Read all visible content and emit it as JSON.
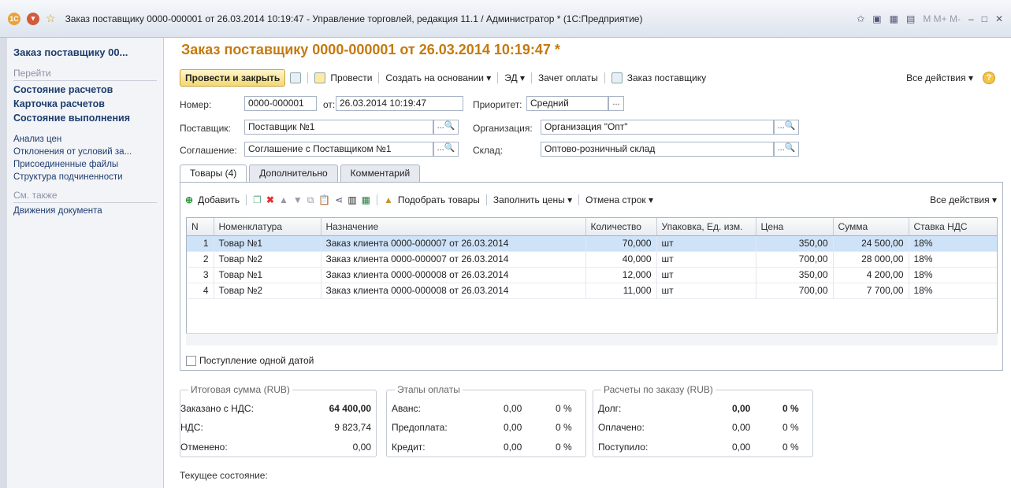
{
  "window": {
    "title": "Заказ поставщику 0000-000001 от 26.03.2014 10:19:47 - Управление торговлей, редакция 11.1 / Администратор * (1С:Предприятие)",
    "right_tools": "M  M+  M-"
  },
  "sidebar": {
    "title": "Заказ поставщику 00...",
    "goto_header": "Перейти",
    "bold_links": [
      "Состояние расчетов",
      "Карточка расчетов",
      "Состояние выполнения"
    ],
    "links": [
      "Анализ цен",
      "Отклонения от условий за...",
      "Присоединенные файлы",
      "Структура подчиненности"
    ],
    "see_also_header": "См. также",
    "see_also_links": [
      "Движения документа"
    ]
  },
  "doc": {
    "title": "Заказ поставщику 0000-000001 от 26.03.2014 10:19:47 *"
  },
  "toolbar": {
    "post_close": "Провести и закрыть",
    "post": "Провести",
    "create_based": "Создать на основании ▾",
    "ed": "ЭД ▾",
    "payment_offset": "Зачет оплаты",
    "print_order": "Заказ поставщику",
    "all_actions": "Все действия ▾"
  },
  "form": {
    "number_label": "Номер:",
    "number": "0000-000001",
    "date_label": "от:",
    "date": "26.03.2014 10:19:47",
    "priority_label": "Приоритет:",
    "priority": "Средний",
    "supplier_label": "Поставщик:",
    "supplier": "Поставщик №1",
    "org_label": "Организация:",
    "org": "Организация \"Опт\"",
    "agreement_label": "Соглашение:",
    "agreement": "Соглашение с Поставщиком №1",
    "warehouse_label": "Склад:",
    "warehouse": "Оптово-розничный склад"
  },
  "tabs": [
    "Товары (4)",
    "Дополнительно",
    "Комментарий"
  ],
  "goods_toolbar": {
    "add": "Добавить",
    "pick": "Подобрать товары",
    "fill_prices": "Заполнить цены ▾",
    "cancel_rows": "Отмена строк ▾",
    "all_actions": "Все действия ▾"
  },
  "goods": {
    "columns": [
      "N",
      "Номенклатура",
      "Назначение",
      "Количество",
      "Упаковка, Ед. изм.",
      "Цена",
      "Сумма",
      "Ставка НДС"
    ],
    "rows": [
      [
        "1",
        "Товар №1",
        "Заказ клиента 0000-000007 от 26.03.2014",
        "70,000",
        "шт",
        "350,00",
        "24 500,00",
        "18%"
      ],
      [
        "2",
        "Товар №2",
        "Заказ клиента 0000-000007 от 26.03.2014",
        "40,000",
        "шт",
        "700,00",
        "28 000,00",
        "18%"
      ],
      [
        "3",
        "Товар №1",
        "Заказ клиента 0000-000008 от 26.03.2014",
        "12,000",
        "шт",
        "350,00",
        "4 200,00",
        "18%"
      ],
      [
        "4",
        "Товар №2",
        "Заказ клиента 0000-000008 от 26.03.2014",
        "11,000",
        "шт",
        "700,00",
        "7 700,00",
        "18%"
      ]
    ]
  },
  "single_date": "Поступление одной датой",
  "totals": {
    "title": "Итоговая сумма (RUB)",
    "ordered_label": "Заказано с НДС:",
    "ordered": "64 400,00",
    "vat_label": "НДС:",
    "vat": "9 823,74",
    "cancelled_label": "Отменено:",
    "cancelled": "0,00"
  },
  "payments": {
    "title": "Этапы оплаты",
    "rows": [
      [
        "Аванс:",
        "0,00",
        "0 %"
      ],
      [
        "Предоплата:",
        "0,00",
        "0 %"
      ],
      [
        "Кредит:",
        "0,00",
        "0 %"
      ]
    ]
  },
  "settlements": {
    "title": "Расчеты по заказу (RUB)",
    "rows": [
      [
        "Долг:",
        "0,00",
        "0 %"
      ],
      [
        "Оплачено:",
        "0,00",
        "0 %"
      ],
      [
        "Поступило:",
        "0,00",
        "0 %"
      ]
    ]
  },
  "status_label": "Текущее состояние:"
}
